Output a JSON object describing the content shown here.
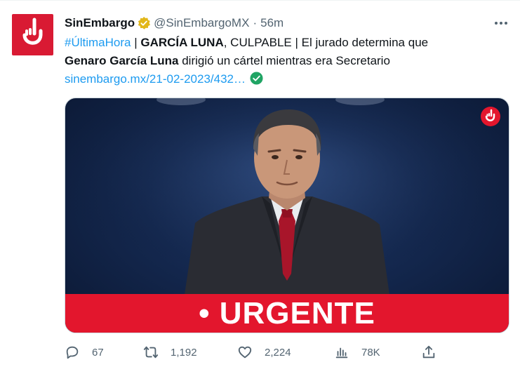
{
  "tweet": {
    "author_name": "SinEmbargo",
    "handle": "@SinEmbargoMX",
    "separator": "·",
    "time": "56m",
    "hashtag": "#ÚltimaHora",
    "sep1": " | ",
    "bold1": "GARCÍA LUNA",
    "t1": ", CULPABLE | El jurado determina que",
    "bold2": "Genaro García Luna",
    "t2": " dirigió un cártel mientras era Secretario",
    "link": "sinembargo.mx/21-02-2023/432…",
    "media_banner": "• URGENTE"
  },
  "actions": {
    "replies": "67",
    "retweets": "1,192",
    "likes": "2,224",
    "views": "78K"
  },
  "icons": {
    "avatar": "sinembargo-logo-icon",
    "verified": "gold-verified-badge-icon",
    "more": "more-dots-icon",
    "link_check": "green-check-circle-icon",
    "reply": "reply-icon",
    "retweet": "retweet-icon",
    "like": "heart-icon",
    "views": "views-chart-icon",
    "share": "share-icon"
  },
  "colors": {
    "brand_red": "#d91a33",
    "link_blue": "#1d9bf0",
    "muted": "#536471",
    "verified_gold": "#e2b719",
    "check_green": "#20a464"
  }
}
